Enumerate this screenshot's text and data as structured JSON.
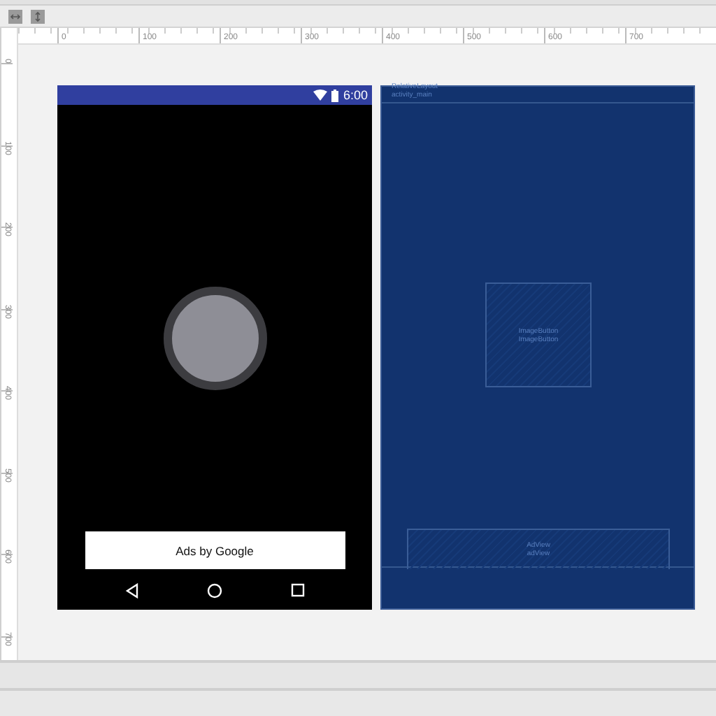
{
  "toolbar": {
    "buttons": [
      {
        "kind": "fit-width"
      },
      {
        "kind": "fit-height"
      }
    ]
  },
  "rulers": {
    "horizontal": [
      "0",
      "100",
      "200",
      "300",
      "400",
      "500",
      "600",
      "700"
    ],
    "vertical": [
      "0",
      "100",
      "200",
      "300",
      "400",
      "500",
      "600",
      "700"
    ]
  },
  "design": {
    "status_bar": {
      "time": "6:00"
    },
    "ad_banner": {
      "text": "Ads by Google"
    },
    "nav_buttons": [
      {
        "kind": "back"
      },
      {
        "kind": "home"
      },
      {
        "kind": "recents"
      }
    ]
  },
  "blueprint": {
    "root": {
      "type": "RelativeLayout",
      "id": "activity_main"
    },
    "views": [
      {
        "kind": "center",
        "type": "ImageButton",
        "id": "ImageButton"
      },
      {
        "kind": "bottom",
        "type": "AdView",
        "id": "adView"
      }
    ]
  }
}
